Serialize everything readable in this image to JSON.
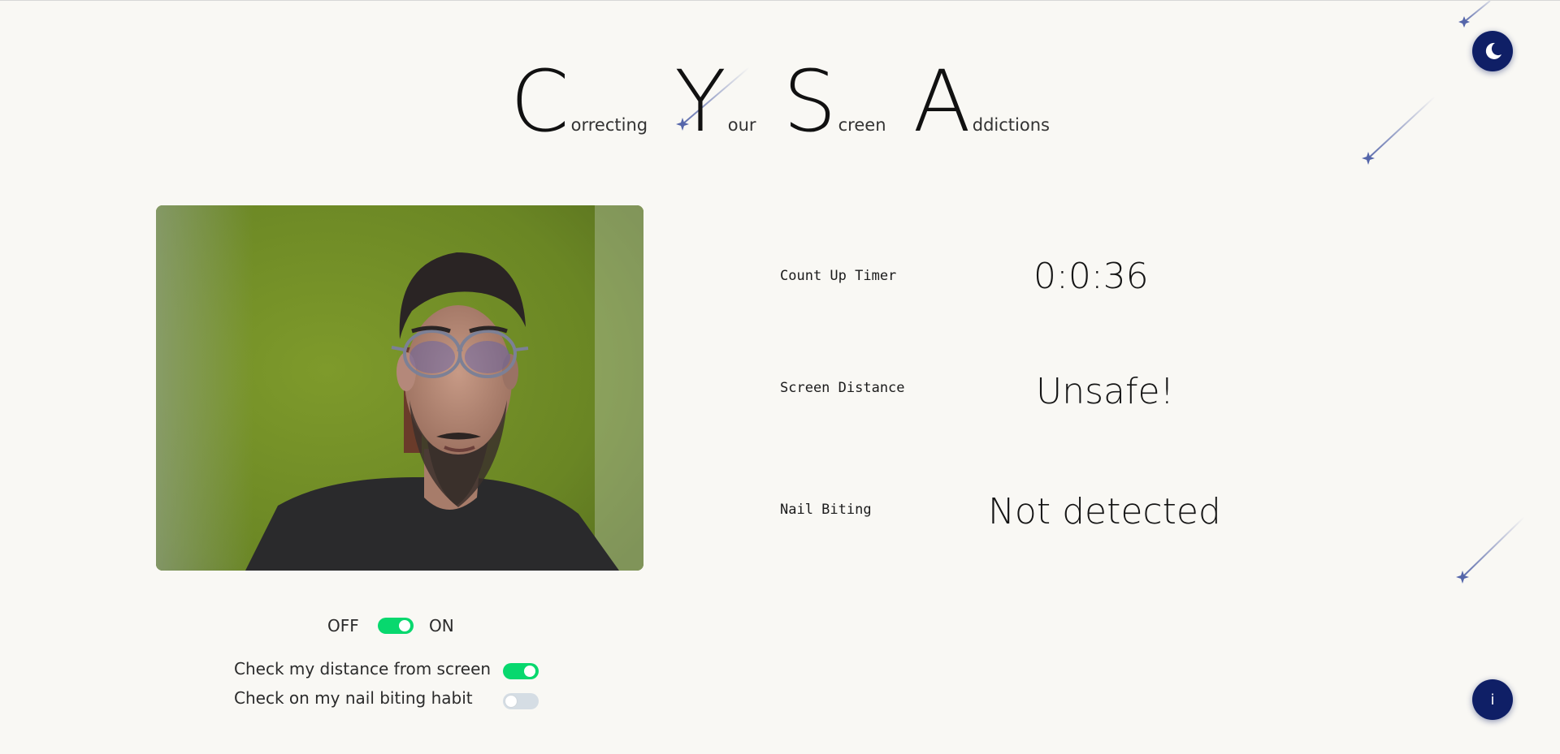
{
  "title": {
    "words": [
      {
        "cap": "C",
        "rest": "orrecting"
      },
      {
        "cap": "Y",
        "rest": "our"
      },
      {
        "cap": "S",
        "rest": "creen"
      },
      {
        "cap": "A",
        "rest": "ddictions"
      }
    ]
  },
  "stats": {
    "timer": {
      "label": "Count Up Timer",
      "value": "0:0:36"
    },
    "distance": {
      "label": "Screen Distance",
      "value": "Unsafe!"
    },
    "nail": {
      "label": "Nail Biting",
      "value": "Not detected"
    }
  },
  "controls": {
    "master": {
      "off_label": "OFF",
      "on_label": "ON",
      "state": "on"
    },
    "distance_check": {
      "label": "Check my distance from screen",
      "state": "on"
    },
    "nail_check": {
      "label": "Check on my nail biting habit",
      "state": "off"
    }
  },
  "buttons": {
    "theme_icon": "moon-icon",
    "info_label": "i"
  },
  "colors": {
    "background": "#f9f8f4",
    "accent_navy": "#0f1f66",
    "toggle_on": "#08d86e",
    "toggle_off": "#d5dde4",
    "star": "#5566aa"
  }
}
